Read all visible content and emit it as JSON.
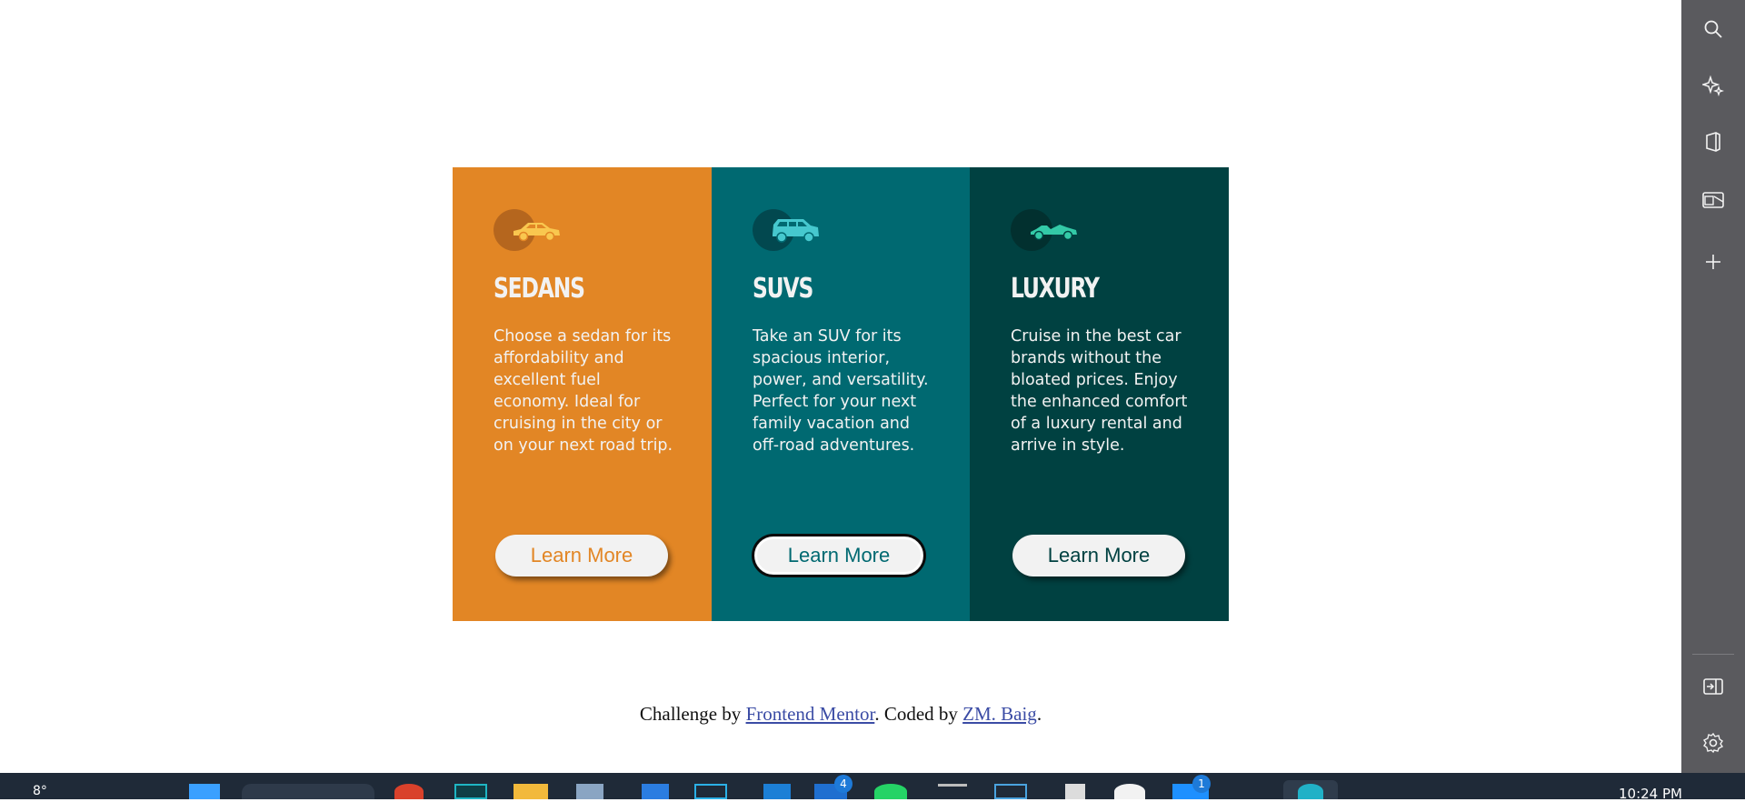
{
  "cards": [
    {
      "title": "SEDANS",
      "text": "Choose a sedan for its affordability and excellent fuel economy. Ideal for cruising in the city or on your next road trip.",
      "button": "Learn More",
      "icon": "sedan-car-icon",
      "color": "#e28625"
    },
    {
      "title": "SUVS",
      "text": "Take an SUV for its spacious interior, power, and versatility. Perfect for your next family vacation and off-road adventures.",
      "button": "Learn More",
      "icon": "suv-car-icon",
      "color": "#006971"
    },
    {
      "title": "LUXURY",
      "text": "Cruise in the best car brands without the bloated prices. Enjoy the enhanced comfort of a luxury rental and arrive in style.",
      "button": "Learn More",
      "icon": "luxury-car-icon",
      "color": "#004141"
    }
  ],
  "attribution": {
    "prefix": "Challenge by ",
    "link1": "Frontend Mentor",
    "middle": ". Coded by ",
    "link2": "ZM. Baig",
    "suffix": "."
  },
  "sidebar": {
    "icons": [
      "search-icon",
      "copilot-sparkle-icon",
      "office-icon",
      "outlook-icon",
      "add-icon",
      "split-screen-icon",
      "settings-icon"
    ]
  },
  "taskbar": {
    "weather_temp": "8°",
    "time": "10:24 PM",
    "badges": [
      "4",
      "1"
    ]
  }
}
